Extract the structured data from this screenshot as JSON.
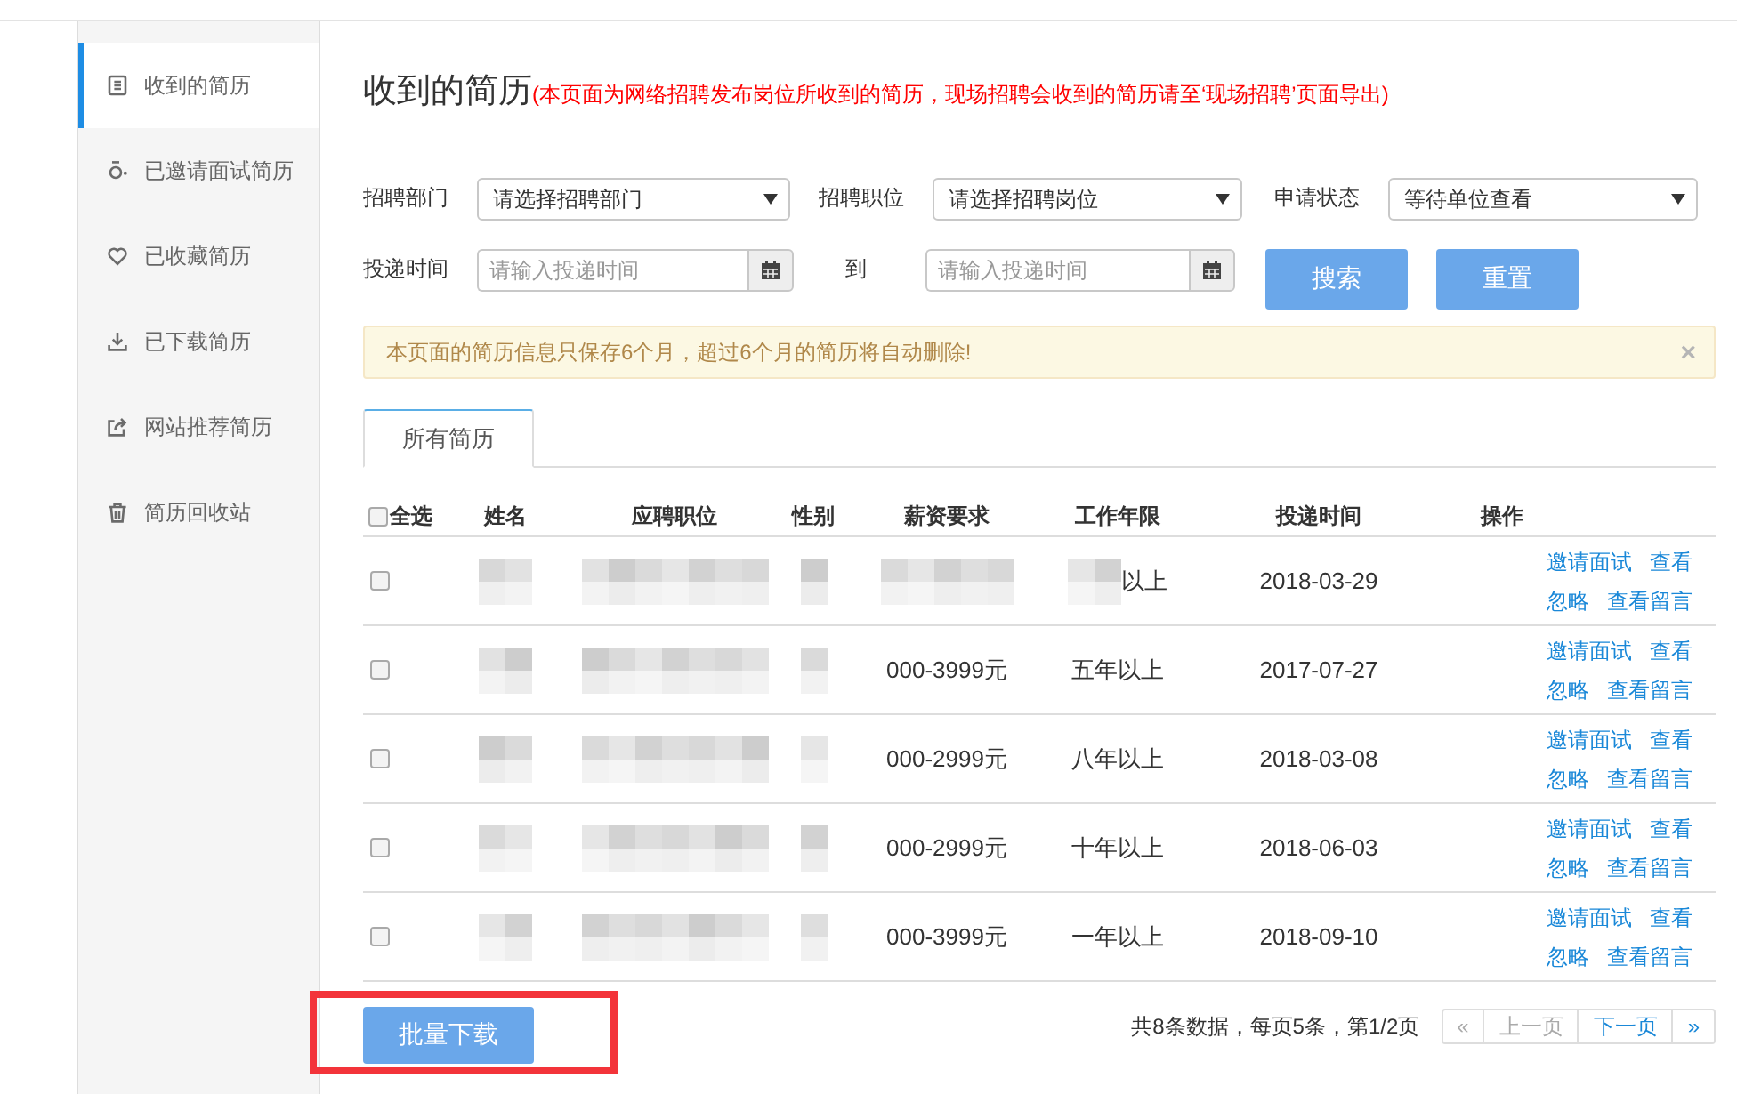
{
  "sidebar": {
    "items": [
      {
        "label": "收到的简历",
        "selected": true
      },
      {
        "label": "已邀请面试简历",
        "selected": false
      },
      {
        "label": "已收藏简历",
        "selected": false
      },
      {
        "label": "已下载简历",
        "selected": false
      },
      {
        "label": "网站推荐简历",
        "selected": false
      },
      {
        "label": "简历回收站",
        "selected": false
      }
    ]
  },
  "header": {
    "title": "收到的简历",
    "note": "(本页面为网络招聘发布岗位所收到的简历，现场招聘会收到的简历请至‘现场招聘’页面导出)"
  },
  "filters": {
    "rows": [
      [
        {
          "kind": "select",
          "label": "招聘部门",
          "value": "请选择招聘部门"
        },
        {
          "kind": "select",
          "label": "招聘职位",
          "value": "请选择招聘岗位"
        },
        {
          "kind": "select",
          "label": "申请状态",
          "value": "等待单位查看"
        }
      ],
      [
        {
          "kind": "date",
          "label": "投递时间",
          "placeholder": "请输入投递时间"
        },
        {
          "kind": "date",
          "label": "到",
          "placeholder": "请输入投递时间"
        }
      ]
    ],
    "buttons": [
      "搜索",
      "重置"
    ]
  },
  "notice": {
    "text": "本页面的简历信息只保存6个月，超过6个月的简历将自动删除!",
    "close": "×"
  },
  "tabs": [
    {
      "label": "所有简历",
      "selected": true
    }
  ],
  "table": {
    "select_all": {
      "label": "全选",
      "checked": false
    },
    "columns": [
      "姓名",
      "应聘职位",
      "性别",
      "薪资要求",
      "工作年限",
      "投递时间",
      "操作"
    ],
    "rows": [
      {
        "checked": false,
        "cells": [
          {
            "masked": true
          },
          {
            "masked": true
          },
          {
            "masked": true
          },
          {
            "masked": true
          },
          {
            "text": "以上",
            "masked": true
          },
          {
            "text": "2018-03-29",
            "masked": false
          }
        ],
        "actions": [
          "邀请面试",
          "查看",
          "忽略",
          "查看留言"
        ]
      },
      {
        "checked": false,
        "cells": [
          {
            "masked": true
          },
          {
            "masked": true
          },
          {
            "masked": true
          },
          {
            "text": "000-3999元",
            "masked": false
          },
          {
            "text": "五年以上",
            "masked": false
          },
          {
            "text": "2017-07-27",
            "masked": false
          }
        ],
        "actions": [
          "邀请面试",
          "查看",
          "忽略",
          "查看留言"
        ]
      },
      {
        "checked": false,
        "cells": [
          {
            "masked": true
          },
          {
            "masked": true
          },
          {
            "masked": true
          },
          {
            "text": "000-2999元",
            "masked": false
          },
          {
            "text": "八年以上",
            "masked": false
          },
          {
            "text": "2018-03-08",
            "masked": false
          }
        ],
        "actions": [
          "邀请面试",
          "查看",
          "忽略",
          "查看留言"
        ]
      },
      {
        "checked": false,
        "cells": [
          {
            "masked": true
          },
          {
            "masked": true
          },
          {
            "masked": true
          },
          {
            "text": "000-2999元",
            "masked": false
          },
          {
            "text": "十年以上",
            "masked": false
          },
          {
            "text": "2018-06-03",
            "masked": false
          }
        ],
        "actions": [
          "邀请面试",
          "查看",
          "忽略",
          "查看留言"
        ]
      },
      {
        "checked": false,
        "cells": [
          {
            "masked": true
          },
          {
            "masked": true
          },
          {
            "masked": true
          },
          {
            "text": "000-3999元",
            "masked": false
          },
          {
            "text": "一年以上",
            "masked": false
          },
          {
            "text": "2018-09-10",
            "masked": false
          }
        ],
        "actions": [
          "邀请面试",
          "查看",
          "忽略",
          "查看留言"
        ]
      }
    ]
  },
  "footer": {
    "batch_button": {
      "label": "批量下载",
      "highlighted": true
    },
    "summary": "共8条数据，每页5条，第1/2页",
    "pager": [
      {
        "label": "«",
        "disabled": true
      },
      {
        "label": "上一页",
        "disabled": true
      },
      {
        "label": "下一页",
        "disabled": false
      },
      {
        "label": "»",
        "disabled": false
      }
    ]
  }
}
